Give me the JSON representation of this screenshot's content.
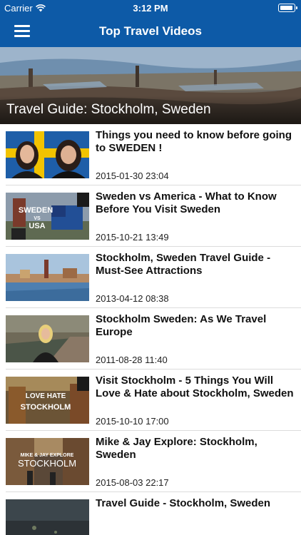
{
  "status": {
    "carrier": "Carrier",
    "time": "3:12 PM"
  },
  "navbar": {
    "title": "Top Travel Videos",
    "menu_icon": "hamburger-menu-icon"
  },
  "hero": {
    "caption": "Travel Guide: Stockholm, Sweden"
  },
  "videos": [
    {
      "title": "Things you need to know before going to SWEDEN !",
      "date": "2015-01-30 23:04"
    },
    {
      "title": "Sweden vs America - What to Know Before You Visit Sweden",
      "date": "2015-10-21 13:49",
      "thumb_text": [
        "SWEDEN",
        "VS",
        "USA"
      ]
    },
    {
      "title": "Stockholm, Sweden Travel Guide - Must-See Attractions",
      "date": "2013-04-12 08:38"
    },
    {
      "title": "Stockholm Sweden: As We Travel Europe",
      "date": "2011-08-28 11:40"
    },
    {
      "title": "Visit Stockholm - 5 Things You Will Love & Hate about Stockholm, Sweden",
      "date": "2015-10-10 17:00",
      "thumb_text": [
        "LOVE HATE",
        "STOCKHOLM"
      ]
    },
    {
      "title": "Mike & Jay Explore: Stockholm, Sweden",
      "date": "2015-08-03 22:17",
      "thumb_text": [
        "MIKE & JAY EXPLORE",
        "STOCKHOLM"
      ]
    },
    {
      "title": "Travel Guide - Stockholm, Sweden",
      "date": ""
    }
  ]
}
